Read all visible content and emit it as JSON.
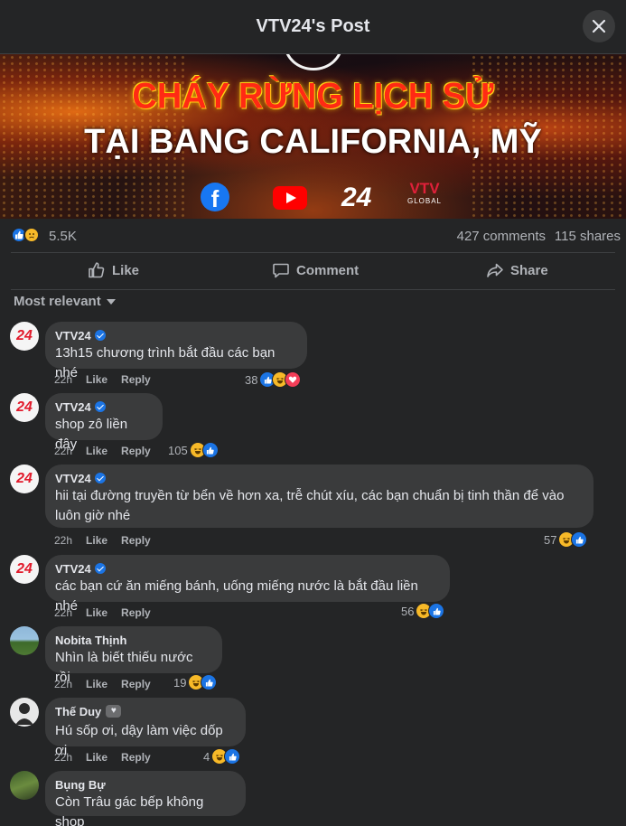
{
  "header": {
    "title": "VTV24's Post"
  },
  "banner": {
    "line1": "CHÁY RỪNG LỊCH SỬ",
    "line2": "TẠI BANG CALIFORNIA, MỸ",
    "logo_fb": "f",
    "logo_24": "24",
    "logo_vtv": "VTV",
    "logo_global": "GLOBAL"
  },
  "stats": {
    "reactions_count": "5.5K",
    "comments": "427 comments",
    "shares": "115 shares"
  },
  "actions": {
    "like": "Like",
    "comment": "Comment",
    "share": "Share"
  },
  "sort": {
    "label": "Most relevant"
  },
  "comments": [
    {
      "author": "VTV24",
      "verified": true,
      "text": "13h15 chương trình bắt đầu các bạn nhé",
      "time": "22h",
      "like": "Like",
      "reply": "Reply",
      "reactions": "38",
      "avatar_text": "24"
    },
    {
      "author": "VTV24",
      "verified": true,
      "text": "shop zô liền đây",
      "time": "22h",
      "like": "Like",
      "reply": "Reply",
      "reactions": "105",
      "avatar_text": "24"
    },
    {
      "author": "VTV24",
      "verified": true,
      "text_line1": "hii tại đường truyền từ bển về hơn xa, trễ chút xíu, các bạn chuẩn bị tinh thần để vào",
      "text_line2": "luôn giờ nhé",
      "time": "22h",
      "like": "Like",
      "reply": "Reply",
      "reactions": "57",
      "avatar_text": "24"
    },
    {
      "author": "VTV24",
      "verified": true,
      "text": "các bạn cứ ăn miếng bánh, uống miếng nước là bắt đầu liền nhé",
      "time": "22h",
      "like": "Like",
      "reply": "Reply",
      "reactions": "56",
      "avatar_text": "24"
    },
    {
      "author": "Nobita Thịnh",
      "text": "Nhìn là biết thiếu nước rồi",
      "time": "22h",
      "like": "Like",
      "reply": "Reply",
      "reactions": "19"
    },
    {
      "author": "Thế Duy",
      "text": "Hú sốp ơi, dậy làm việc dốp ơi",
      "time": "22h",
      "like": "Like",
      "reply": "Reply",
      "reactions": "4"
    },
    {
      "author": "Bụng Bự",
      "text": "Còn Trâu gác bếp không shop"
    }
  ]
}
